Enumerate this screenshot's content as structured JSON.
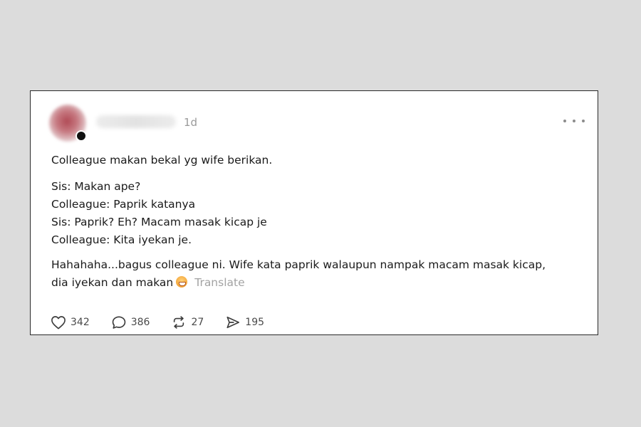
{
  "post": {
    "time": "1d",
    "intro": "Colleague makan bekal yg wife berikan.",
    "dialog": [
      "Sis: Makan ape?",
      "Colleague: Paprik katanya",
      "Sis: Paprik? Eh? Macam masak kicap je",
      "Colleague: Kita iyekan je."
    ],
    "closing_line1": "Hahahaha...bagus colleague ni. Wife kata paprik walaupun nampak macam masak kicap,",
    "closing_line2": "dia iyekan dan makan",
    "emoji": "grimacing-face-emoji",
    "translate_label": "Translate"
  },
  "actions": {
    "likes": "342",
    "comments": "386",
    "reposts": "27",
    "shares": "195"
  },
  "icons": {
    "like": "heart-icon",
    "comment": "comment-bubble-icon",
    "repost": "repost-icon",
    "share": "send-icon",
    "more": "more-options-icon"
  },
  "colors": {
    "background": "#dcdcdc",
    "card": "#ffffff",
    "text": "#1a1a1a",
    "muted": "#9a9a9a"
  }
}
